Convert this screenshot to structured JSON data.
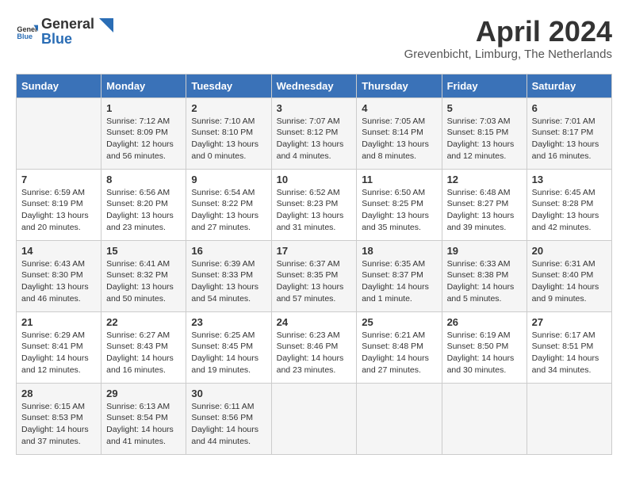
{
  "logo": {
    "general": "General",
    "blue": "Blue"
  },
  "title": "April 2024",
  "subtitle": "Grevenbicht, Limburg, The Netherlands",
  "days_of_week": [
    "Sunday",
    "Monday",
    "Tuesday",
    "Wednesday",
    "Thursday",
    "Friday",
    "Saturday"
  ],
  "weeks": [
    [
      {
        "day": "",
        "info": ""
      },
      {
        "day": "1",
        "info": "Sunrise: 7:12 AM\nSunset: 8:09 PM\nDaylight: 12 hours\nand 56 minutes."
      },
      {
        "day": "2",
        "info": "Sunrise: 7:10 AM\nSunset: 8:10 PM\nDaylight: 13 hours\nand 0 minutes."
      },
      {
        "day": "3",
        "info": "Sunrise: 7:07 AM\nSunset: 8:12 PM\nDaylight: 13 hours\nand 4 minutes."
      },
      {
        "day": "4",
        "info": "Sunrise: 7:05 AM\nSunset: 8:14 PM\nDaylight: 13 hours\nand 8 minutes."
      },
      {
        "day": "5",
        "info": "Sunrise: 7:03 AM\nSunset: 8:15 PM\nDaylight: 13 hours\nand 12 minutes."
      },
      {
        "day": "6",
        "info": "Sunrise: 7:01 AM\nSunset: 8:17 PM\nDaylight: 13 hours\nand 16 minutes."
      }
    ],
    [
      {
        "day": "7",
        "info": "Sunrise: 6:59 AM\nSunset: 8:19 PM\nDaylight: 13 hours\nand 20 minutes."
      },
      {
        "day": "8",
        "info": "Sunrise: 6:56 AM\nSunset: 8:20 PM\nDaylight: 13 hours\nand 23 minutes."
      },
      {
        "day": "9",
        "info": "Sunrise: 6:54 AM\nSunset: 8:22 PM\nDaylight: 13 hours\nand 27 minutes."
      },
      {
        "day": "10",
        "info": "Sunrise: 6:52 AM\nSunset: 8:23 PM\nDaylight: 13 hours\nand 31 minutes."
      },
      {
        "day": "11",
        "info": "Sunrise: 6:50 AM\nSunset: 8:25 PM\nDaylight: 13 hours\nand 35 minutes."
      },
      {
        "day": "12",
        "info": "Sunrise: 6:48 AM\nSunset: 8:27 PM\nDaylight: 13 hours\nand 39 minutes."
      },
      {
        "day": "13",
        "info": "Sunrise: 6:45 AM\nSunset: 8:28 PM\nDaylight: 13 hours\nand 42 minutes."
      }
    ],
    [
      {
        "day": "14",
        "info": "Sunrise: 6:43 AM\nSunset: 8:30 PM\nDaylight: 13 hours\nand 46 minutes."
      },
      {
        "day": "15",
        "info": "Sunrise: 6:41 AM\nSunset: 8:32 PM\nDaylight: 13 hours\nand 50 minutes."
      },
      {
        "day": "16",
        "info": "Sunrise: 6:39 AM\nSunset: 8:33 PM\nDaylight: 13 hours\nand 54 minutes."
      },
      {
        "day": "17",
        "info": "Sunrise: 6:37 AM\nSunset: 8:35 PM\nDaylight: 13 hours\nand 57 minutes."
      },
      {
        "day": "18",
        "info": "Sunrise: 6:35 AM\nSunset: 8:37 PM\nDaylight: 14 hours\nand 1 minute."
      },
      {
        "day": "19",
        "info": "Sunrise: 6:33 AM\nSunset: 8:38 PM\nDaylight: 14 hours\nand 5 minutes."
      },
      {
        "day": "20",
        "info": "Sunrise: 6:31 AM\nSunset: 8:40 PM\nDaylight: 14 hours\nand 9 minutes."
      }
    ],
    [
      {
        "day": "21",
        "info": "Sunrise: 6:29 AM\nSunset: 8:41 PM\nDaylight: 14 hours\nand 12 minutes."
      },
      {
        "day": "22",
        "info": "Sunrise: 6:27 AM\nSunset: 8:43 PM\nDaylight: 14 hours\nand 16 minutes."
      },
      {
        "day": "23",
        "info": "Sunrise: 6:25 AM\nSunset: 8:45 PM\nDaylight: 14 hours\nand 19 minutes."
      },
      {
        "day": "24",
        "info": "Sunrise: 6:23 AM\nSunset: 8:46 PM\nDaylight: 14 hours\nand 23 minutes."
      },
      {
        "day": "25",
        "info": "Sunrise: 6:21 AM\nSunset: 8:48 PM\nDaylight: 14 hours\nand 27 minutes."
      },
      {
        "day": "26",
        "info": "Sunrise: 6:19 AM\nSunset: 8:50 PM\nDaylight: 14 hours\nand 30 minutes."
      },
      {
        "day": "27",
        "info": "Sunrise: 6:17 AM\nSunset: 8:51 PM\nDaylight: 14 hours\nand 34 minutes."
      }
    ],
    [
      {
        "day": "28",
        "info": "Sunrise: 6:15 AM\nSunset: 8:53 PM\nDaylight: 14 hours\nand 37 minutes."
      },
      {
        "day": "29",
        "info": "Sunrise: 6:13 AM\nSunset: 8:54 PM\nDaylight: 14 hours\nand 41 minutes."
      },
      {
        "day": "30",
        "info": "Sunrise: 6:11 AM\nSunset: 8:56 PM\nDaylight: 14 hours\nand 44 minutes."
      },
      {
        "day": "",
        "info": ""
      },
      {
        "day": "",
        "info": ""
      },
      {
        "day": "",
        "info": ""
      },
      {
        "day": "",
        "info": ""
      }
    ]
  ]
}
